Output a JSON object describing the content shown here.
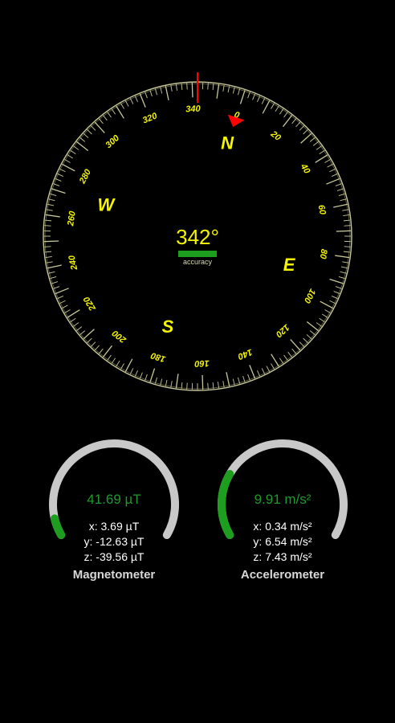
{
  "compass": {
    "heading": 342,
    "heading_text": "342°",
    "accuracy_label": "accuracy",
    "accuracy_color": "#1e9e1e",
    "dial_color": "#c8c89a",
    "label_color": "#f5f500",
    "pointer_color": "#ff0000",
    "degree_labels": [
      "0",
      "20",
      "40",
      "60",
      "80",
      "100",
      "120",
      "140",
      "160",
      "180",
      "200",
      "220",
      "240",
      "260",
      "280",
      "300",
      "320",
      "340"
    ],
    "cardinals": [
      "N",
      "E",
      "S",
      "W"
    ]
  },
  "sensors": {
    "magnetometer": {
      "value_text": "41.69 µT",
      "x_text": "x: 3.69 µT",
      "y_text": "y: -12.63 µT",
      "z_text": "z: -39.56 µT",
      "title": "Magnetometer",
      "level": 0.07
    },
    "accelerometer": {
      "value_text": "9.91 m/s²",
      "x_text": "x: 0.34 m/s²",
      "y_text": "y: 6.54 m/s²",
      "z_text": "z: 7.43 m/s²",
      "title": "Accelerometer",
      "level": 0.25
    }
  },
  "colors": {
    "gauge_track": "#c8c8c8",
    "gauge_fill": "#1e9e1e",
    "background": "#000000"
  }
}
